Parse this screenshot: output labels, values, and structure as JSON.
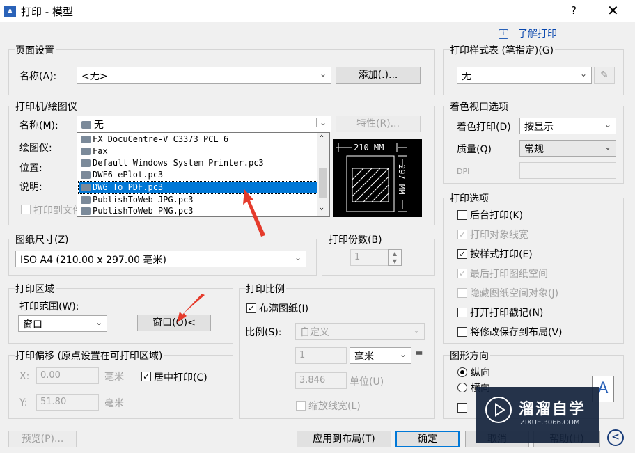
{
  "window": {
    "title": "打印 - 模型",
    "help": "?",
    "close": "✕"
  },
  "learn": {
    "info": "i",
    "label": "了解打印"
  },
  "page_setup": {
    "group": "页面设置",
    "name_label": "名称(A):",
    "name_value": "<无>",
    "add_button": "添加(.)..."
  },
  "printer": {
    "group": "打印机/绘图仪",
    "name_label": "名称(M):",
    "name_value": "无",
    "props_button": "特性(R)...",
    "plotter_label": "绘图仪:",
    "location_label": "位置:",
    "desc_label": "说明:",
    "print_to_file": "打印到文件",
    "dropdown_items": [
      "FX DocuCentre-V C3373 PCL 6",
      "Fax",
      "Default Windows System Printer.pc3",
      "DWF6 ePlot.pc3",
      "DWG To PDF.pc3",
      "PublishToWeb JPG.pc3",
      "PublishToWeb PNG.pc3"
    ],
    "preview_width": "210 MM",
    "preview_height": "297 MM"
  },
  "paper_size": {
    "group": "图纸尺寸(Z)",
    "value": "ISO A4 (210.00 x 297.00 毫米)"
  },
  "copies": {
    "group": "打印份数(B)",
    "value": "1"
  },
  "plot_area": {
    "group": "打印区域",
    "range_label": "打印范围(W):",
    "range_value": "窗口",
    "window_button": "窗口(O)<"
  },
  "plot_offset": {
    "group": "打印偏移 (原点设置在可打印区域)",
    "x_label": "X:",
    "x_value": "0.00",
    "y_label": "Y:",
    "y_value": "51.80",
    "unit": "毫米",
    "center": "居中打印(C)"
  },
  "plot_scale": {
    "group": "打印比例",
    "fit": "布满图纸(I)",
    "scale_label": "比例(S):",
    "scale_value": "自定义",
    "num_value": "1",
    "unit_value": "毫米",
    "equals": "=",
    "den_value": "3.846",
    "unit_label": "单位(U)",
    "lineweights": "缩放线宽(L)"
  },
  "plot_style": {
    "group": "打印样式表 (笔指定)(G)",
    "value": "无"
  },
  "shaded": {
    "group": "着色视口选项",
    "shade_label": "着色打印(D)",
    "shade_value": "按显示",
    "quality_label": "质量(Q)",
    "quality_value": "常规",
    "dpi_label": "DPI"
  },
  "plot_options": {
    "group": "打印选项",
    "items": [
      {
        "label": "后台打印(K)",
        "checked": "",
        "enabled": true
      },
      {
        "label": "打印对象线宽",
        "checked": "✓",
        "enabled": false
      },
      {
        "label": "按样式打印(E)",
        "checked": "✓",
        "enabled": true
      },
      {
        "label": "最后打印图纸空间",
        "checked": "✓",
        "enabled": false
      },
      {
        "label": "隐藏图纸空间对象(J)",
        "checked": "",
        "enabled": false
      },
      {
        "label": "打开打印戳记(N)",
        "checked": "",
        "enabled": true
      },
      {
        "label": "将修改保存到布局(V)",
        "checked": "",
        "enabled": true
      }
    ]
  },
  "orientation": {
    "group": "图形方向",
    "portrait": "纵向",
    "landscape": "横向",
    "icon_letter": "A"
  },
  "footer": {
    "preview": "预览(P)...",
    "apply": "应用到布局(T)",
    "ok": "确定",
    "cancel": "取消",
    "help": "帮助(H)",
    "more": "<"
  },
  "watermark": {
    "title": "溜溜自学",
    "sub": "ZIXUE.3066.COM"
  }
}
